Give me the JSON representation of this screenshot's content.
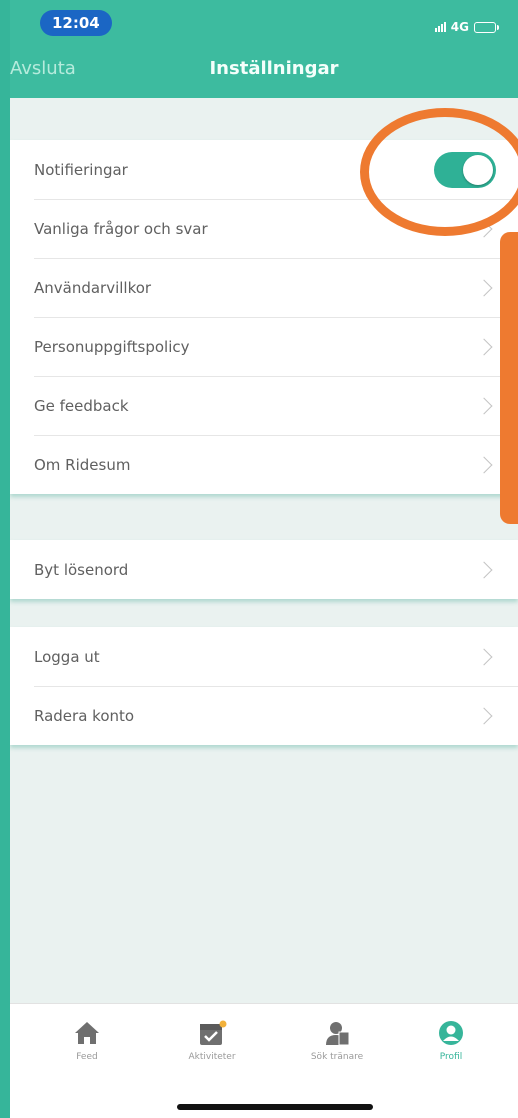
{
  "status_bar": {
    "time": "12:04",
    "network": "4G"
  },
  "nav": {
    "back_label": "Avsluta",
    "title": "Inställningar"
  },
  "groups": [
    {
      "rows": [
        {
          "label": "Notifieringar",
          "control": "toggle",
          "toggle_on": true
        },
        {
          "label": "Vanliga frågor och svar",
          "control": "chevron"
        },
        {
          "label": "Användarvillkor",
          "control": "chevron"
        },
        {
          "label": "Personuppgiftspolicy",
          "control": "chevron"
        },
        {
          "label": "Ge feedback",
          "control": "chevron"
        },
        {
          "label": "Om Ridesum",
          "control": "chevron"
        }
      ]
    },
    {
      "rows": [
        {
          "label": "Byt lösenord",
          "control": "chevron"
        }
      ]
    },
    {
      "rows": [
        {
          "label": "Logga ut",
          "control": "chevron"
        },
        {
          "label": "Radera konto",
          "control": "chevron"
        }
      ]
    }
  ],
  "tabbar": {
    "tabs": [
      {
        "label": "Feed",
        "icon": "home-icon",
        "active": false
      },
      {
        "label": "Aktiviteter",
        "icon": "calendar-check-icon",
        "active": false
      },
      {
        "label": "Sök tränare",
        "icon": "trainer-search-icon",
        "active": false
      },
      {
        "label": "Profil",
        "icon": "profile-icon",
        "active": true
      }
    ]
  },
  "colors": {
    "header": "#3dbb9f",
    "accent": "#2fb196",
    "annotation": "#ee7a30",
    "time_pill": "#1b66c4"
  }
}
